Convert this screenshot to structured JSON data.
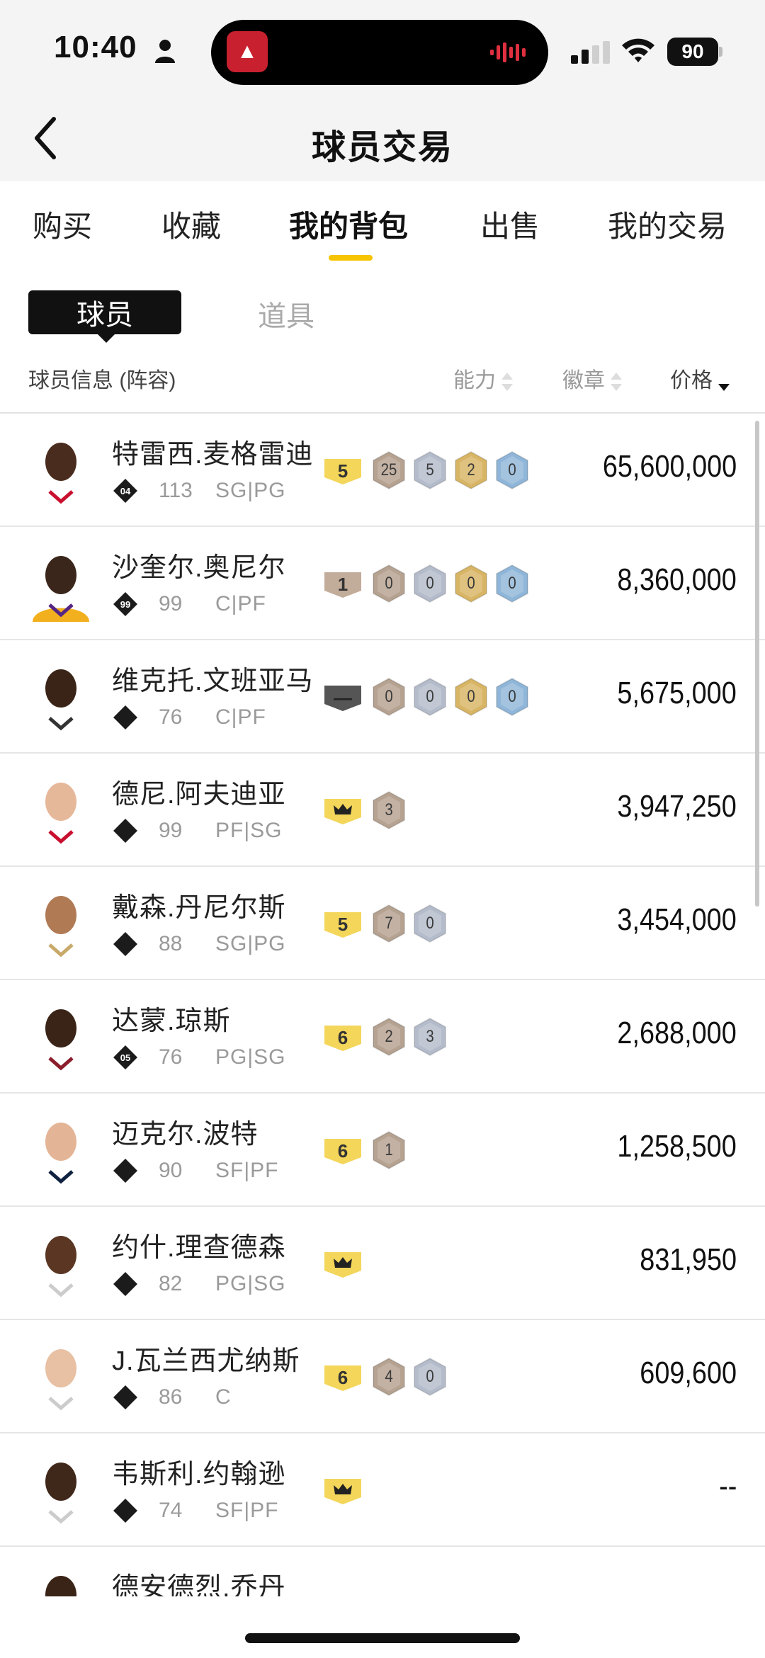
{
  "status": {
    "time": "10:40",
    "battery": "90"
  },
  "nav": {
    "title": "球员交易"
  },
  "tabs": [
    {
      "label": "购买"
    },
    {
      "label": "收藏"
    },
    {
      "label": "我的背包",
      "active": true
    },
    {
      "label": "出售"
    },
    {
      "label": "我的交易"
    }
  ],
  "subtabs": {
    "player": "球员",
    "items": "道具"
  },
  "columns": {
    "info": "球员信息 (阵容)",
    "ability": "能力",
    "badge": "徽章",
    "price": "价格"
  },
  "colors": {
    "accent": "#f6c400",
    "level_gold": "#f3d65a",
    "hex_brown": "#b6a291",
    "hex_silver": "#b4bccb",
    "hex_gold": "#d8b565",
    "hex_blue": "#8fb6d8"
  },
  "players": [
    {
      "name": "特雷西.麦格雷迪",
      "tier": "04",
      "ovr": "113",
      "pos": "SG|PG",
      "level": "5",
      "level_type": "gold",
      "badges": [
        "25",
        "5",
        "2",
        "0"
      ],
      "price": "65,600,000",
      "skin": "#4a2c1e",
      "jersey": "#ffffff",
      "jersey_trim": "#c8102e"
    },
    {
      "name": "沙奎尔.奥尼尔",
      "tier": "99",
      "ovr": "99",
      "pos": "C|PF",
      "level": "1",
      "level_type": "brown",
      "badges": [
        "0",
        "0",
        "0",
        "0"
      ],
      "price": "8,360,000",
      "skin": "#3b261b",
      "jersey": "#f2b01e",
      "jersey_trim": "#552583"
    },
    {
      "name": "维克托.文班亚马",
      "tier": "",
      "ovr": "76",
      "pos": "C|PF",
      "level": "—",
      "level_type": "dark",
      "badges": [
        "0",
        "0",
        "0",
        "0"
      ],
      "price": "5,675,000",
      "skin": "#3a2418",
      "jersey": "#ffffff",
      "jersey_trim": "#333333"
    },
    {
      "name": "德尼.阿夫迪亚",
      "tier": "",
      "ovr": "99",
      "pos": "PF|SG",
      "level": "crown",
      "level_type": "crown",
      "badges": [
        "3"
      ],
      "price": "3,947,250",
      "skin": "#e6b89a",
      "jersey": "#ffffff",
      "jersey_trim": "#c8102e"
    },
    {
      "name": "戴森.丹尼尔斯",
      "tier": "",
      "ovr": "88",
      "pos": "SG|PG",
      "level": "5",
      "level_type": "gold",
      "badges": [
        "7",
        "0"
      ],
      "price": "3,454,000",
      "skin": "#b07a55",
      "jersey": "#ffffff",
      "jersey_trim": "#c8a96a"
    },
    {
      "name": "达蒙.琼斯",
      "tier": "05",
      "ovr": "76",
      "pos": "PG|SG",
      "level": "6",
      "level_type": "gold",
      "badges": [
        "2",
        "3"
      ],
      "price": "2,688,000",
      "skin": "#3a2418",
      "jersey": "#ffffff",
      "jersey_trim": "#8b1d2c"
    },
    {
      "name": "迈克尔.波特",
      "tier": "",
      "ovr": "90",
      "pos": "SF|PF",
      "level": "6",
      "level_type": "gold",
      "badges": [
        "1"
      ],
      "price": "1,258,500",
      "skin": "#e3b596",
      "jersey": "#ffffff",
      "jersey_trim": "#0e2240"
    },
    {
      "name": "约什.理查德森",
      "tier": "",
      "ovr": "82",
      "pos": "PG|SG",
      "level": "crown",
      "level_type": "crown",
      "badges": [],
      "price": "831,950",
      "skin": "#5a3623",
      "jersey": "#ffffff",
      "jersey_trim": "#cccccc"
    },
    {
      "name": "J.瓦兰西尤纳斯",
      "tier": "",
      "ovr": "86",
      "pos": "C",
      "level": "6",
      "level_type": "gold",
      "badges": [
        "4",
        "0"
      ],
      "price": "609,600",
      "skin": "#e8c0a3",
      "jersey": "#ffffff",
      "jersey_trim": "#cccccc"
    },
    {
      "name": "韦斯利.约翰逊",
      "tier": "",
      "ovr": "74",
      "pos": "SF|PF",
      "level": "crown",
      "level_type": "crown",
      "badges": [],
      "price": "--",
      "skin": "#3f271a",
      "jersey": "#ffffff",
      "jersey_trim": "#cccccc"
    },
    {
      "name": "德安德烈.乔丹",
      "tier": "",
      "ovr": "",
      "pos": "",
      "level": "",
      "level_type": "gold",
      "badges": [],
      "price": "",
      "skin": "#3a2418",
      "jersey": "#ffffff",
      "jersey_trim": "#cccccc"
    }
  ]
}
